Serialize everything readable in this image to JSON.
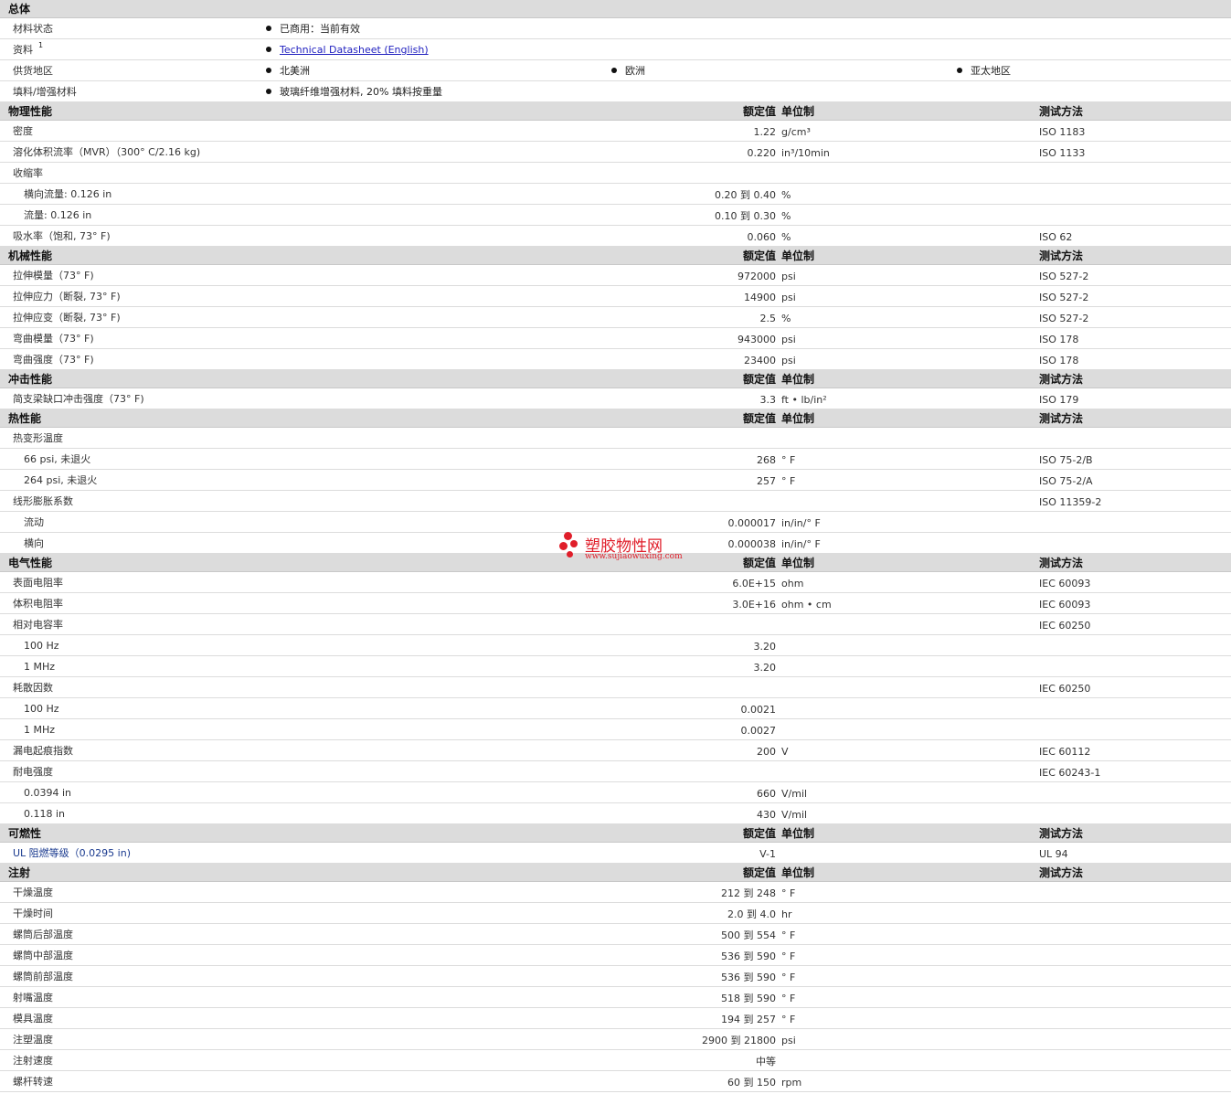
{
  "general": {
    "title": "总体",
    "rows": [
      {
        "name": "材料状态",
        "values": [
          "已商用：当前有效"
        ]
      },
      {
        "name": "资料",
        "sup": "1",
        "values": [
          "Technical Datasheet (English)"
        ],
        "link": true
      },
      {
        "name": "供货地区",
        "values": [
          "北美洲",
          "欧洲",
          "亚太地区"
        ]
      },
      {
        "name": "填料/增强材料",
        "values": [
          "玻璃纤维增强材料, 20% 填料按重量"
        ]
      }
    ]
  },
  "headers": {
    "value": "额定值",
    "unit": "单位制",
    "method": "测试方法"
  },
  "sections": [
    {
      "title": "物理性能",
      "rows": [
        {
          "name": "密度",
          "value": "1.22",
          "unit": "g/cm³",
          "method": "ISO 1183"
        },
        {
          "name": "溶化体积流率（MVR）（300° C/2.16 kg)",
          "value": "0.220",
          "unit": "in³/10min",
          "method": "ISO 1133"
        },
        {
          "name": "收缩率",
          "value": "",
          "unit": "",
          "method": ""
        },
        {
          "name": "横向流量: 0.126 in",
          "sub": true,
          "value": "0.20 到  0.40",
          "unit": "%",
          "method": ""
        },
        {
          "name": "流量: 0.126 in",
          "sub": true,
          "value": "0.10 到  0.30",
          "unit": "%",
          "method": ""
        },
        {
          "name": "吸水率（饱和, 73° F)",
          "value": "0.060",
          "unit": "%",
          "method": "ISO 62"
        }
      ]
    },
    {
      "title": "机械性能",
      "rows": [
        {
          "name": "拉伸模量（73° F)",
          "value": "972000",
          "unit": "psi",
          "method": "ISO 527-2"
        },
        {
          "name": "拉伸应力（断裂, 73° F)",
          "value": "14900",
          "unit": "psi",
          "method": "ISO 527-2"
        },
        {
          "name": "拉伸应变（断裂, 73° F)",
          "value": "2.5",
          "unit": "%",
          "method": "ISO 527-2"
        },
        {
          "name": "弯曲模量（73° F)",
          "value": "943000",
          "unit": "psi",
          "method": "ISO 178"
        },
        {
          "name": "弯曲强度（73° F)",
          "value": "23400",
          "unit": "psi",
          "method": "ISO 178"
        }
      ]
    },
    {
      "title": "冲击性能",
      "rows": [
        {
          "name": "简支梁缺口冲击强度（73° F)",
          "value": "3.3",
          "unit": "ft • lb/in²",
          "method": "ISO 179"
        }
      ]
    },
    {
      "title": "热性能",
      "rows": [
        {
          "name": "热变形温度",
          "value": "",
          "unit": "",
          "method": ""
        },
        {
          "name": "66 psi, 未退火",
          "sub": true,
          "value": "268",
          "unit": "° F",
          "method": "ISO 75-2/B"
        },
        {
          "name": "264 psi, 未退火",
          "sub": true,
          "value": "257",
          "unit": "° F",
          "method": "ISO 75-2/A"
        },
        {
          "name": "线形膨胀系数",
          "value": "",
          "unit": "",
          "method": "ISO 11359-2"
        },
        {
          "name": "流动",
          "sub": true,
          "value": "0.000017",
          "unit": "in/in/° F",
          "method": ""
        },
        {
          "name": "横向",
          "sub": true,
          "value": "0.000038",
          "unit": "in/in/° F",
          "method": ""
        }
      ]
    },
    {
      "title": "电气性能",
      "rows": [
        {
          "name": "表面电阻率",
          "value": "6.0E+15",
          "unit": "ohm",
          "method": "IEC 60093"
        },
        {
          "name": "体积电阻率",
          "value": "3.0E+16",
          "unit": "ohm • cm",
          "method": "IEC 60093"
        },
        {
          "name": "相对电容率",
          "value": "",
          "unit": "",
          "method": "IEC 60250"
        },
        {
          "name": "100 Hz",
          "sub": true,
          "value": "3.20",
          "unit": "",
          "method": ""
        },
        {
          "name": "1 MHz",
          "sub": true,
          "value": "3.20",
          "unit": "",
          "method": ""
        },
        {
          "name": "耗散因数",
          "value": "",
          "unit": "",
          "method": "IEC 60250"
        },
        {
          "name": "100 Hz",
          "sub": true,
          "value": "0.0021",
          "unit": "",
          "method": ""
        },
        {
          "name": "1 MHz",
          "sub": true,
          "value": "0.0027",
          "unit": "",
          "method": ""
        },
        {
          "name": "漏电起痕指数",
          "value": "200",
          "unit": "V",
          "method": "IEC 60112"
        },
        {
          "name": "耐电强度",
          "value": "",
          "unit": "",
          "method": "IEC 60243-1"
        },
        {
          "name": "0.0394 in",
          "sub": true,
          "value": "660",
          "unit": "V/mil",
          "method": ""
        },
        {
          "name": "0.118 in",
          "sub": true,
          "value": "430",
          "unit": "V/mil",
          "method": ""
        }
      ]
    },
    {
      "title": "可燃性",
      "rows": [
        {
          "name": "UL 阻燃等级（0.0295 in)",
          "blue": true,
          "value": "V-1",
          "unit": "",
          "method": "UL 94"
        }
      ]
    },
    {
      "title": "注射",
      "rows": [
        {
          "name": "干燥温度",
          "value": "212 到  248",
          "unit": "° F",
          "method": ""
        },
        {
          "name": "干燥时间",
          "value": "2.0 到  4.0",
          "unit": "hr",
          "method": ""
        },
        {
          "name": "螺筒后部温度",
          "value": "500 到  554",
          "unit": "° F",
          "method": ""
        },
        {
          "name": "螺筒中部温度",
          "value": "536 到  590",
          "unit": "° F",
          "method": ""
        },
        {
          "name": "螺筒前部温度",
          "value": "536 到  590",
          "unit": "° F",
          "method": ""
        },
        {
          "name": "射嘴温度",
          "value": "518 到  590",
          "unit": "° F",
          "method": ""
        },
        {
          "name": "模具温度",
          "value": "194 到  257",
          "unit": "° F",
          "method": ""
        },
        {
          "name": "注塑温度",
          "value": "2900 到  21800",
          "unit": "psi",
          "method": ""
        },
        {
          "name": "注射速度",
          "value": "中等",
          "unit": "",
          "method": ""
        },
        {
          "name": "螺杆转速",
          "value": "60 到  150",
          "unit": "rpm",
          "method": ""
        }
      ]
    }
  ],
  "watermark": {
    "title": "塑胶物性网",
    "url": "www.sujiaowuxing.com",
    "color": "#e01e2a"
  }
}
